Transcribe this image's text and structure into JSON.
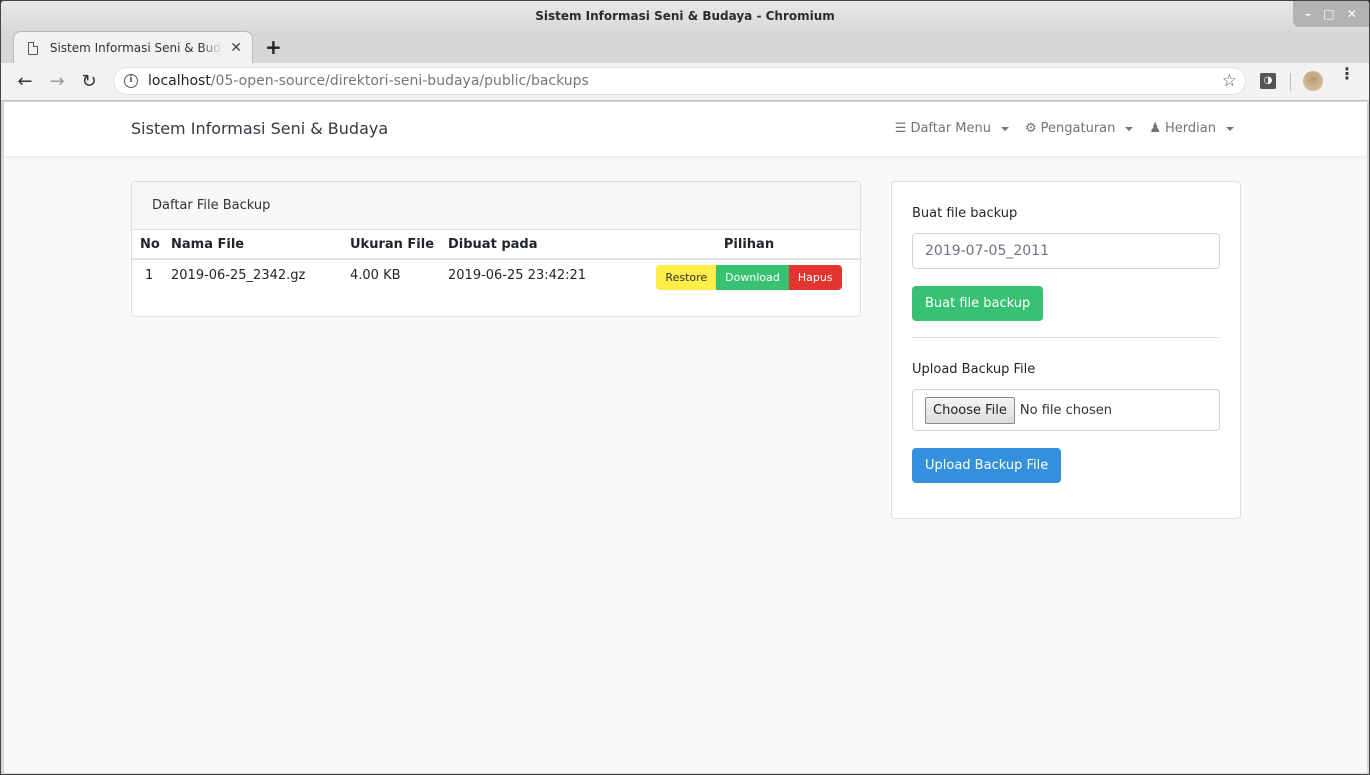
{
  "window": {
    "title": "Sistem Informasi Seni & Budaya - Chromium",
    "controls": [
      "minimize",
      "maximize",
      "close"
    ]
  },
  "browser": {
    "tab_title": "Sistem Informasi Seni & Budaya",
    "new_tab_label": "+",
    "url_host": "localhost",
    "url_path": "/05-open-source/direktori-seni-budaya/public/backups"
  },
  "navbar": {
    "brand": "Sistem Informasi Seni & Budaya",
    "items": [
      {
        "label": "Daftar Menu",
        "icon": "bars-icon"
      },
      {
        "label": "Pengaturan",
        "icon": "cogs-icon"
      },
      {
        "label": "Herdian",
        "icon": "user-icon"
      }
    ]
  },
  "backup_list": {
    "title": "Daftar File Backup",
    "columns": [
      "No",
      "Nama File",
      "Ukuran File",
      "Dibuat pada",
      "Pilihan"
    ],
    "rows": [
      {
        "no": "1",
        "name": "2019-06-25_2342.gz",
        "size": "4.00 KB",
        "created": "2019-06-25 23:42:21"
      }
    ],
    "actions": {
      "restore": "Restore",
      "download": "Download",
      "delete": "Hapus"
    }
  },
  "create_backup": {
    "label": "Buat file backup",
    "input_value": "2019-07-05_2011",
    "button": "Buat file backup"
  },
  "upload_backup": {
    "label": "Upload Backup File",
    "choose_button": "Choose File",
    "no_file_text": "No file chosen",
    "button": "Upload Backup File"
  },
  "colors": {
    "restore": "#ffed4a",
    "download": "#38c172",
    "delete": "#e3342f",
    "primary": "#3490dc",
    "success": "#38c172"
  }
}
